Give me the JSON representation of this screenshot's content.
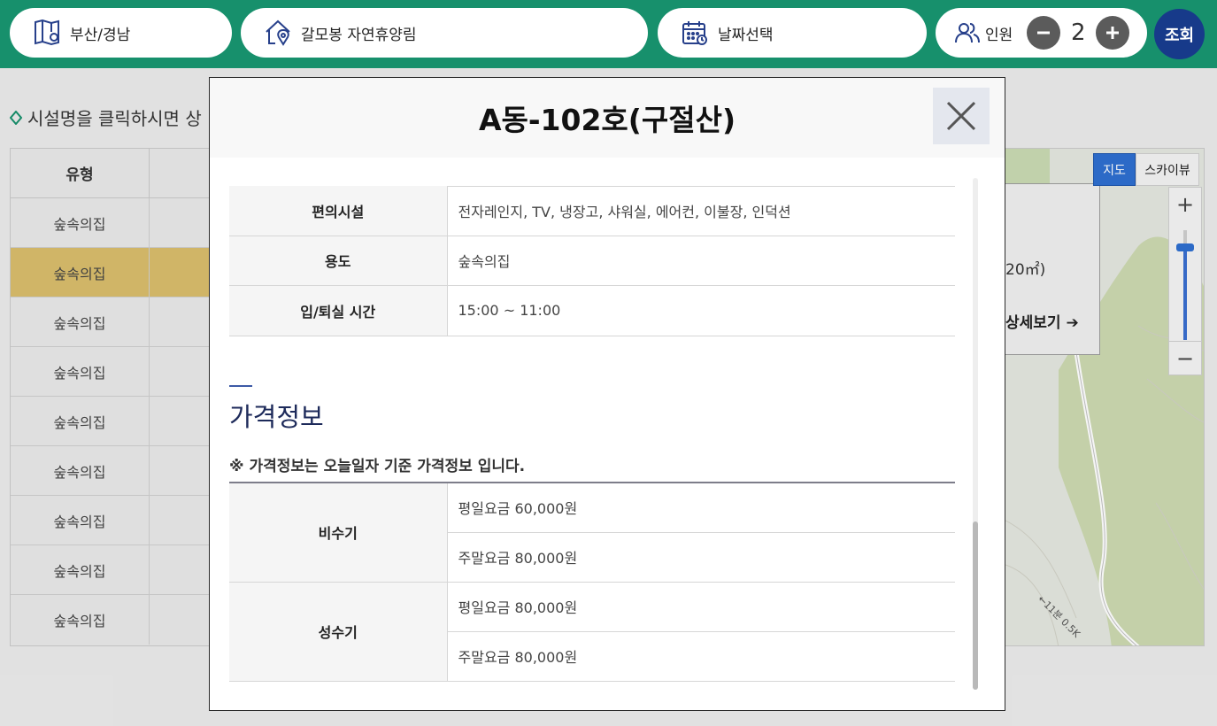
{
  "search": {
    "region": "부산/경남",
    "forest": "갈모봉 자연휴양림",
    "date_placeholder": "날짜선택",
    "people_label": "인원",
    "people_count": "2",
    "search_button": "조회"
  },
  "background": {
    "notice": "시설명을 클릭하시면 상",
    "table_header_type": "유형",
    "rows": [
      "숲속의집",
      "숲속의집",
      "숲속의집",
      "숲속의집",
      "숲속의집",
      "숲속의집",
      "숲속의집",
      "숲속의집",
      "숲속의집"
    ],
    "selected_row": 1
  },
  "map": {
    "toggle_map": "지도",
    "toggle_sky": "스카이뷰",
    "zoom_in": "+",
    "zoom_out": "−",
    "info_area": "20㎡)",
    "info_more": "상세보기 ➔",
    "scale_label": "←11분 0.5K"
  },
  "modal": {
    "title": "A동-102호(구절산)",
    "info_rows": [
      {
        "label": "편의시설",
        "value": "전자레인지, TV, 냉장고, 샤워실, 에어컨, 이불장, 인덕션"
      },
      {
        "label": "용도",
        "value": "숲속의집"
      },
      {
        "label": "입/퇴실 시간",
        "value": "15:00 ~ 11:00"
      }
    ],
    "price_section": {
      "title": "가격정보",
      "note": "※ 가격정보는 오늘일자 기준 가격정보 입니다.",
      "groups": [
        {
          "season": "비수기",
          "weekday": "평일요금 60,000원",
          "weekend": "주말요금 80,000원"
        },
        {
          "season": "성수기",
          "weekday": "평일요금 80,000원",
          "weekend": "주말요금 80,000원"
        }
      ]
    }
  },
  "colors": {
    "header_green": "#17906c",
    "search_navy": "#173a8a",
    "selected_row": "#d9bd6c",
    "map_toggle_active": "#2e6fd0"
  }
}
